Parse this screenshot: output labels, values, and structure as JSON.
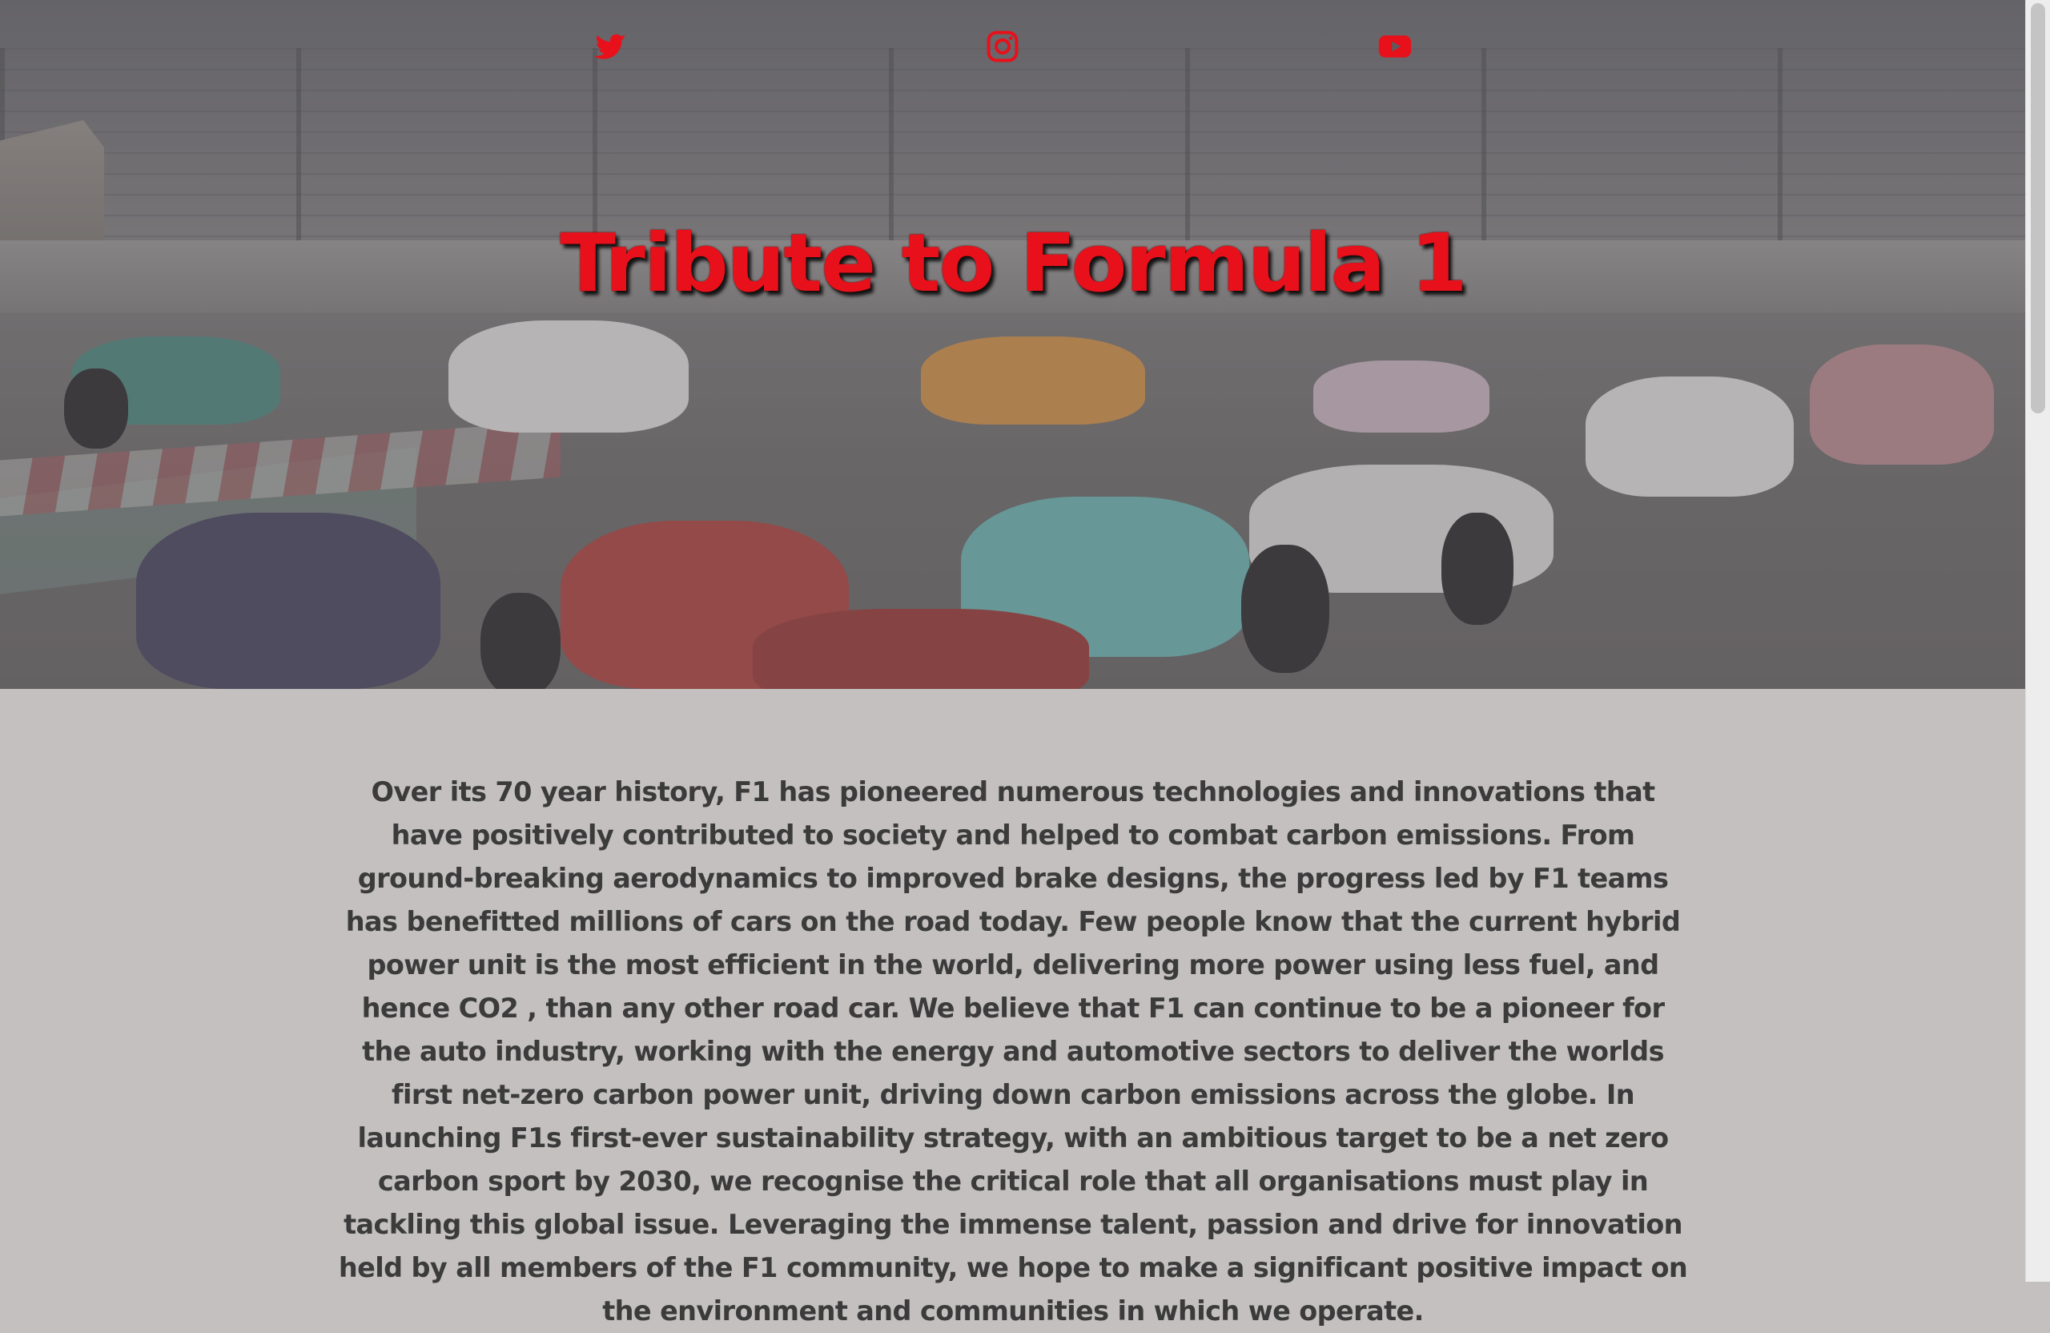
{
  "socials": [
    {
      "name": "twitter",
      "icon": "twitter-icon"
    },
    {
      "name": "instagram",
      "icon": "instagram-icon"
    },
    {
      "name": "youtube",
      "icon": "youtube-icon"
    }
  ],
  "colors": {
    "accent": "#e8101a",
    "body_background": "#c3c0bf",
    "text": "#3c3b3c"
  },
  "hero": {
    "title": "Tribute to Formula 1",
    "background_image": "formula-1-race-start-photo"
  },
  "main": {
    "paragraph": "Over its 70 year history, F1 has pioneered numerous technologies and innovations that have positively contributed to society and helped to combat carbon emissions. From ground-breaking aerodynamics to improved brake designs, the progress led by F1 teams has benefitted millions of cars on the road today. Few people know that the current hybrid power unit is the most efficient in the world, delivering more power using less fuel, and hence CO2 , than any other road car. We believe that F1 can continue to be a pioneer for the auto industry, working with the energy and automotive sectors to deliver the worlds first net-zero carbon power unit, driving down carbon emissions across the globe. In launching F1s first-ever sustainability strategy, with an ambitious target to be a net zero carbon sport by 2030, we recognise the critical role that all organisations must play in tackling this global issue. Leveraging the immense talent, passion and drive for innovation held by all members of the F1 community, we hope to make a significant positive impact on the environment and communities in which we operate."
  }
}
